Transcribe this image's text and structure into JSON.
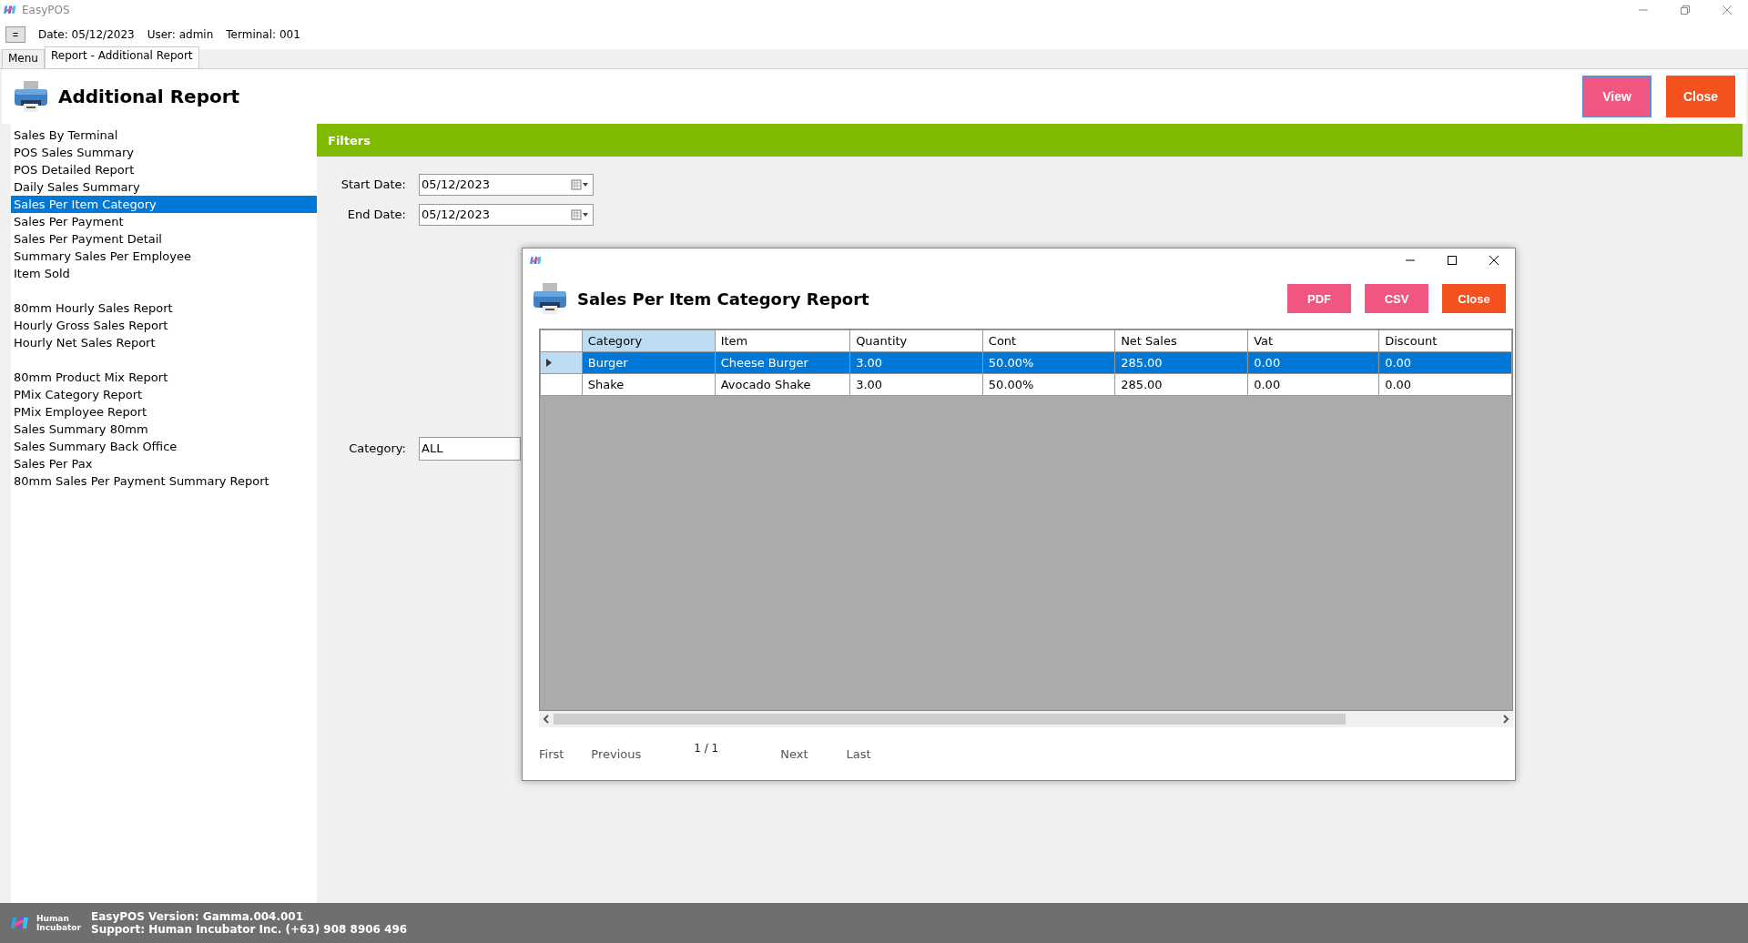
{
  "window": {
    "title": "EasyPOS"
  },
  "toolbar": {
    "menu_button": "=",
    "date": "Date: 05/12/2023",
    "user": "User: admin",
    "terminal": "Terminal: 001"
  },
  "tabs": [
    {
      "label": "Menu",
      "selected": false
    },
    {
      "label": "Report - Additional Report",
      "selected": true
    }
  ],
  "page": {
    "title": "Additional Report",
    "buttons": [
      {
        "label": "View",
        "kind": "primary"
      },
      {
        "label": "Close",
        "kind": "close"
      }
    ]
  },
  "report_groups": [
    {
      "items": [
        {
          "label": "Sales By Terminal",
          "selected": false
        },
        {
          "label": "POS Sales Summary",
          "selected": false
        },
        {
          "label": "POS Detailed Report",
          "selected": false
        },
        {
          "label": "Daily Sales Summary",
          "selected": false
        },
        {
          "label": "Sales Per Item Category",
          "selected": true
        },
        {
          "label": "Sales Per Payment",
          "selected": false
        },
        {
          "label": "Sales Per Payment Detail",
          "selected": false
        },
        {
          "label": "Summary Sales Per Employee",
          "selected": false
        },
        {
          "label": "Item Sold",
          "selected": false
        }
      ]
    },
    {
      "items": [
        {
          "label": "80mm Hourly Sales Report",
          "selected": false
        },
        {
          "label": "Hourly Gross Sales Report",
          "selected": false
        },
        {
          "label": "Hourly Net Sales Report",
          "selected": false
        }
      ]
    },
    {
      "items": [
        {
          "label": "80mm Product Mix Report",
          "selected": false
        },
        {
          "label": "PMix Category Report",
          "selected": false
        },
        {
          "label": "PMix Employee Report",
          "selected": false
        },
        {
          "label": "Sales Summary 80mm",
          "selected": false
        },
        {
          "label": "Sales Summary Back Office",
          "selected": false
        },
        {
          "label": "Sales Per Pax",
          "selected": false
        },
        {
          "label": "80mm Sales Per Payment Summary Report",
          "selected": false
        }
      ]
    }
  ],
  "filters": {
    "title": "Filters",
    "start_date": {
      "label": "Start Date:",
      "value": "05/12/2023"
    },
    "end_date": {
      "label": "End Date:",
      "value": "05/12/2023"
    },
    "category": {
      "label": "Category:",
      "value": "ALL"
    }
  },
  "dialog": {
    "title": "Sales Per Item Category Report",
    "buttons": [
      {
        "label": "PDF",
        "kind": "export"
      },
      {
        "label": "CSV",
        "kind": "export"
      },
      {
        "label": "Close",
        "kind": "close"
      }
    ],
    "table": {
      "columns": [
        {
          "label": "Category",
          "selected": true
        },
        {
          "label": "Item",
          "selected": false
        },
        {
          "label": "Quantity",
          "selected": false
        },
        {
          "label": "Cont",
          "selected": false
        },
        {
          "label": "Net Sales",
          "selected": false
        },
        {
          "label": "Vat",
          "selected": false
        },
        {
          "label": "Discount",
          "selected": false
        }
      ],
      "rows": [
        {
          "selected": true,
          "cells": [
            "Burger",
            "Cheese Burger",
            "3.00",
            "50.00%",
            "285.00",
            "0.00",
            "0.00"
          ]
        },
        {
          "selected": false,
          "cells": [
            "Shake",
            "Avocado Shake",
            "3.00",
            "50.00%",
            "285.00",
            "0.00",
            "0.00"
          ]
        }
      ]
    },
    "pagination": {
      "first": "First",
      "previous": "Previous",
      "page": "1 / 1",
      "next": "Next",
      "last": "Last"
    }
  },
  "status_bar": {
    "logo_text": "Human Incubator",
    "version": "EasyPOS Version: Gamma.004.001",
    "support": "Support: Human Incubator Inc. (+63) 908 8906 496"
  }
}
